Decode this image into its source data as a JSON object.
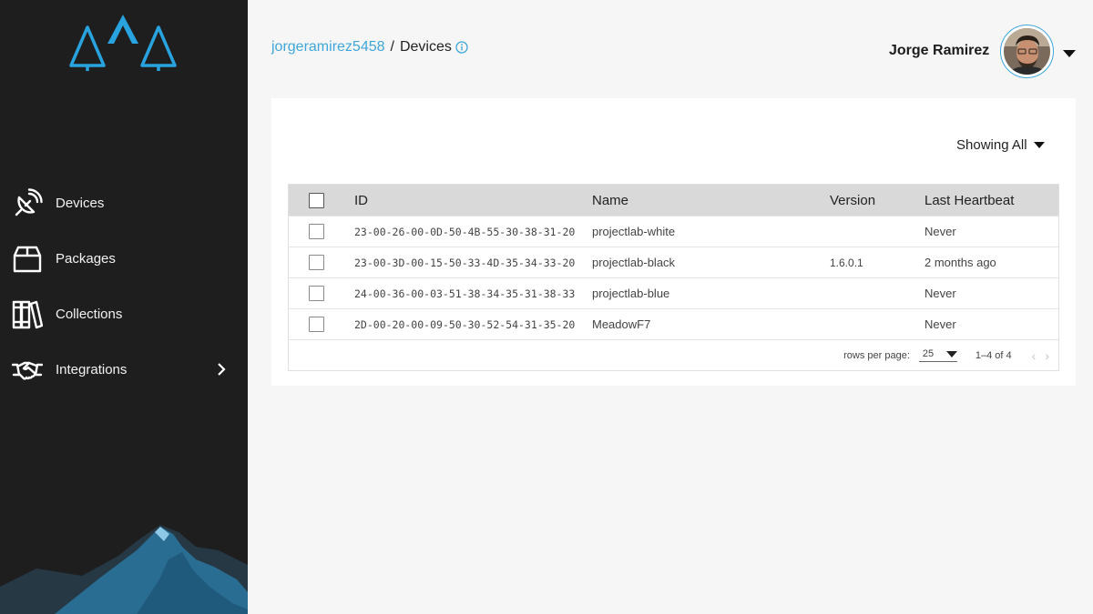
{
  "app": {
    "brand_color": "#29a3df",
    "sidebar_bg": "#1e1e1e"
  },
  "sidebar": {
    "items": [
      {
        "label": "Devices",
        "icon": "satellite-dish-icon"
      },
      {
        "label": "Packages",
        "icon": "box-icon"
      },
      {
        "label": "Collections",
        "icon": "books-icon"
      },
      {
        "label": "Integrations",
        "icon": "handshake-icon",
        "has_submenu": true
      }
    ]
  },
  "header": {
    "breadcrumb_user": "jorgeramirez5458",
    "breadcrumb_separator": "/",
    "breadcrumb_page": "Devices",
    "user_name": "Jorge Ramirez"
  },
  "filter": {
    "label": "Showing All"
  },
  "table": {
    "columns": [
      "ID",
      "Name",
      "Version",
      "Last Heartbeat"
    ],
    "rows": [
      {
        "id": "23-00-26-00-0D-50-4B-55-30-38-31-20",
        "name": "projectlab-white",
        "version": "",
        "heartbeat": "Never"
      },
      {
        "id": "23-00-3D-00-15-50-33-4D-35-34-33-20",
        "name": "projectlab-black",
        "version": "1.6.0.1",
        "heartbeat": "2 months ago"
      },
      {
        "id": "24-00-36-00-03-51-38-34-35-31-38-33",
        "name": "projectlab-blue",
        "version": "",
        "heartbeat": "Never"
      },
      {
        "id": "2D-00-20-00-09-50-30-52-54-31-35-20",
        "name": "MeadowF7",
        "version": "",
        "heartbeat": "Never"
      }
    ]
  },
  "pagination": {
    "rows_per_page_label": "rows per page:",
    "rows_per_page": "25",
    "range": "1–4 of 4"
  }
}
